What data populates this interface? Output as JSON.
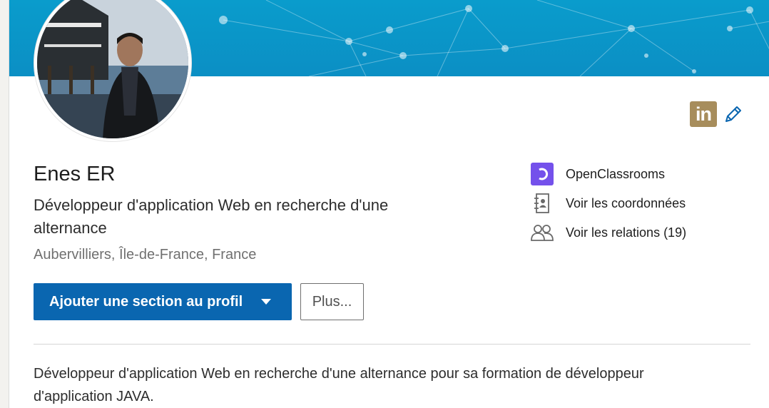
{
  "profile": {
    "name": "Enes ER",
    "headline": "Développeur d'application Web en recherche d'une alternance",
    "location": "Aubervilliers, Île-de-France, France",
    "summary": "Développeur d'application Web en recherche d'une alternance pour sa formation de développeur d'application JAVA."
  },
  "actions": {
    "add_section_label": "Ajouter une section au profil",
    "more_label": "Plus..."
  },
  "badge": {
    "linkedin_text": "in",
    "linkedin_icon": "linkedin-icon",
    "edit_icon": "pencil-icon"
  },
  "side": {
    "school": "OpenClassrooms",
    "contact_label": "Voir les coordonnées",
    "relations_label": "Voir les relations (19)"
  },
  "colors": {
    "banner": "#0b94c8",
    "primary_button": "#0a66b0",
    "linkedin_badge": "#a78d5c",
    "openclassrooms": "#7451eb"
  }
}
